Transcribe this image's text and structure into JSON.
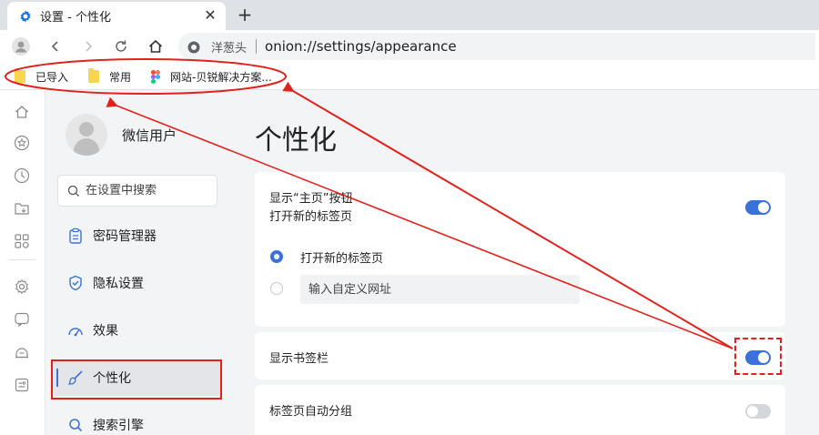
{
  "browser": {
    "tab": {
      "title": "设置 - 个性化",
      "close_icon": "close-icon"
    },
    "new_tab_label": "+",
    "address": {
      "site_name": "洋葱头",
      "url": "onion://settings/appearance"
    },
    "bookmarks": [
      {
        "label": "已导入",
        "icon": "folder-icon"
      },
      {
        "label": "常用",
        "icon": "folder-icon"
      },
      {
        "label": "网站-贝锐解决方案...",
        "icon": "figma-icon"
      }
    ]
  },
  "sidebar": {
    "profile_name": "微信用户",
    "search_placeholder": "在设置中搜索",
    "items": [
      {
        "label": "密码管理器",
        "icon": "clipboard-icon"
      },
      {
        "label": "隐私设置",
        "icon": "shield-icon"
      },
      {
        "label": "效果",
        "icon": "gauge-icon"
      },
      {
        "label": "个性化",
        "icon": "brush-icon",
        "active": true
      },
      {
        "label": "搜索引擎",
        "icon": "search-icon"
      }
    ]
  },
  "main": {
    "title": "个性化",
    "home_button": {
      "title": "显示“主页”按钮",
      "subtitle": "打开新的标签页",
      "enabled": true,
      "options": [
        {
          "label": "打开新的标签页",
          "checked": true
        },
        {
          "label": "",
          "checked": false
        }
      ],
      "custom_url_placeholder": "输入自定义网址"
    },
    "bookmarks_bar": {
      "title": "显示书签栏",
      "enabled": true
    },
    "tab_grouping": {
      "title": "标签页自动分组",
      "enabled": false
    }
  },
  "colors": {
    "accent": "#3a72d9",
    "annotation": "#e0221c"
  }
}
